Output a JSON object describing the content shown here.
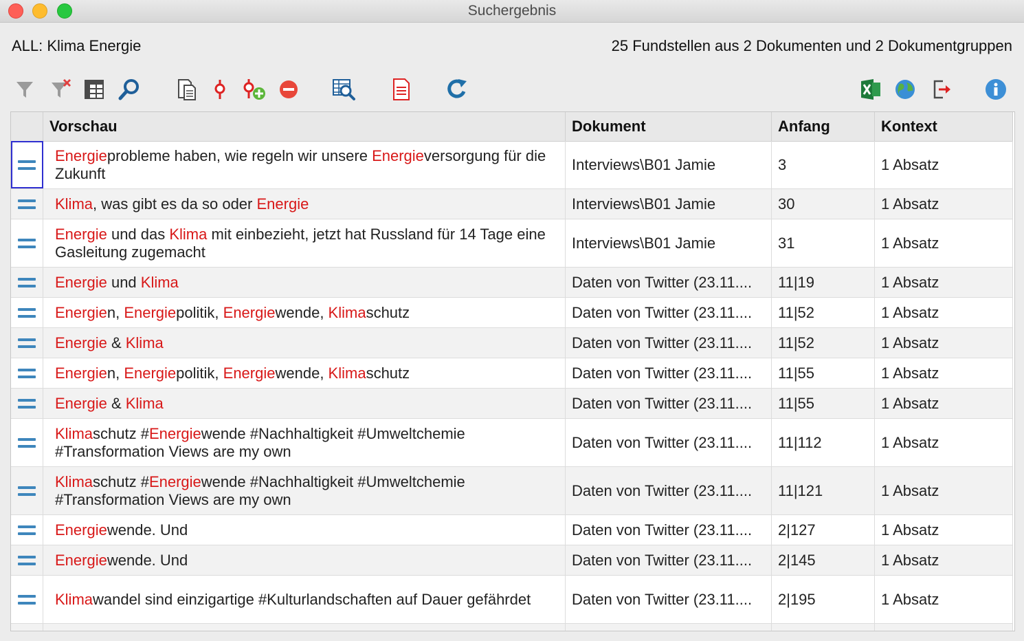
{
  "window": {
    "title": "Suchergebnis"
  },
  "header": {
    "search_term": "ALL: Klima Energie",
    "summary": "25 Fundstellen aus 2 Dokumenten und 2 Dokumentgruppen"
  },
  "toolbar": {
    "left": [
      "filter-icon",
      "clear-filter-icon",
      "table-columns-icon",
      "search-icon",
      "document-list-icon",
      "coded-segment-icon",
      "add-code-icon",
      "remove-icon",
      "search-table-icon",
      "text-report-icon",
      "refresh-icon"
    ],
    "right": [
      "excel-export-icon",
      "web-export-icon",
      "export-icon",
      "info-icon"
    ]
  },
  "table": {
    "columns": [
      "",
      "Vorschau",
      "Dokument",
      "Anfang",
      "Kontext"
    ],
    "rows": [
      {
        "preview": [
          [
            "Energie",
            true
          ],
          [
            "probleme haben, wie regeln wir unsere ",
            false
          ],
          [
            "Energie",
            true
          ],
          [
            "versorgung für die Zukunft",
            false
          ]
        ],
        "document": "Interviews\\B01 Jamie",
        "start": "3",
        "context": "1 Absatz"
      },
      {
        "preview": [
          [
            "Klima",
            true
          ],
          [
            ", was gibt es da so oder ",
            false
          ],
          [
            "Energie",
            true
          ]
        ],
        "document": "Interviews\\B01 Jamie",
        "start": "30",
        "context": "1 Absatz"
      },
      {
        "preview": [
          [
            "Energie",
            true
          ],
          [
            " und das ",
            false
          ],
          [
            "Klima",
            true
          ],
          [
            " mit einbezieht, jetzt hat Russland für 14 Tage eine Gasleitung zugemacht",
            false
          ]
        ],
        "document": "Interviews\\B01 Jamie",
        "start": "31",
        "context": "1 Absatz"
      },
      {
        "preview": [
          [
            "Energie",
            true
          ],
          [
            " und ",
            false
          ],
          [
            "Klima",
            true
          ]
        ],
        "document": "Daten von Twitter (23.11....",
        "start": "11|19",
        "context": "1 Absatz"
      },
      {
        "preview": [
          [
            "Energie",
            true
          ],
          [
            "n, ",
            false
          ],
          [
            "Energie",
            true
          ],
          [
            "politik, ",
            false
          ],
          [
            "Energie",
            true
          ],
          [
            "wende, ",
            false
          ],
          [
            "Klima",
            true
          ],
          [
            "schutz",
            false
          ]
        ],
        "document": "Daten von Twitter (23.11....",
        "start": "11|52",
        "context": "1 Absatz"
      },
      {
        "preview": [
          [
            "Energie",
            true
          ],
          [
            " & ",
            false
          ],
          [
            "Klima",
            true
          ]
        ],
        "document": "Daten von Twitter (23.11....",
        "start": "11|52",
        "context": "1 Absatz"
      },
      {
        "preview": [
          [
            "Energie",
            true
          ],
          [
            "n, ",
            false
          ],
          [
            "Energie",
            true
          ],
          [
            "politik, ",
            false
          ],
          [
            "Energie",
            true
          ],
          [
            "wende, ",
            false
          ],
          [
            "Klima",
            true
          ],
          [
            "schutz",
            false
          ]
        ],
        "document": "Daten von Twitter (23.11....",
        "start": "11|55",
        "context": "1 Absatz"
      },
      {
        "preview": [
          [
            "Energie",
            true
          ],
          [
            " & ",
            false
          ],
          [
            "Klima",
            true
          ]
        ],
        "document": "Daten von Twitter (23.11....",
        "start": "11|55",
        "context": "1 Absatz"
      },
      {
        "preview": [
          [
            "Klima",
            true
          ],
          [
            "schutz #",
            false
          ],
          [
            "Energie",
            true
          ],
          [
            "wende #Nachhaltigkeit #Umweltchemie #Transformation Views are my own",
            false
          ]
        ],
        "document": "Daten von Twitter (23.11....",
        "start": "11|112",
        "context": "1 Absatz"
      },
      {
        "preview": [
          [
            "Klima",
            true
          ],
          [
            "schutz #",
            false
          ],
          [
            "Energie",
            true
          ],
          [
            "wende #Nachhaltigkeit #Umweltchemie #Transformation Views are my own",
            false
          ]
        ],
        "document": "Daten von Twitter (23.11....",
        "start": "11|121",
        "context": "1 Absatz"
      },
      {
        "preview": [
          [
            "Energie",
            true
          ],
          [
            "wende. Und",
            false
          ]
        ],
        "document": "Daten von Twitter (23.11....",
        "start": "2|127",
        "context": "1 Absatz"
      },
      {
        "preview": [
          [
            "Energie",
            true
          ],
          [
            "wende. Und",
            false
          ]
        ],
        "document": "Daten von Twitter (23.11....",
        "start": "2|145",
        "context": "1 Absatz"
      },
      {
        "preview": [
          [
            "Klima",
            true
          ],
          [
            "wandel sind einzigartige #Kulturlandschaften auf Dauer gefährdet",
            false
          ]
        ],
        "document": "Daten von Twitter (23.11....",
        "start": "2|195",
        "context": "1 Absatz"
      }
    ]
  },
  "colors": {
    "highlight": "#d81818",
    "handle": "#3e86bc",
    "selection": "#2f2fd0"
  }
}
